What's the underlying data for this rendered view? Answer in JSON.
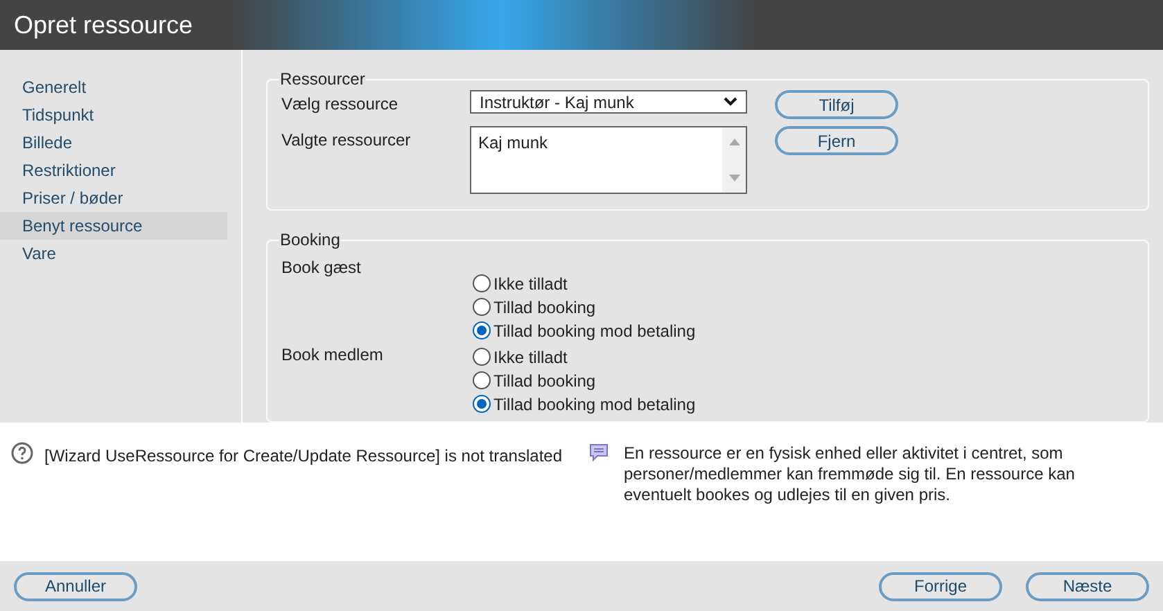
{
  "window": {
    "title": "Opret ressource"
  },
  "sidebar": {
    "items": [
      {
        "label": "Generelt",
        "selected": false
      },
      {
        "label": "Tidspunkt",
        "selected": false
      },
      {
        "label": "Billede",
        "selected": false
      },
      {
        "label": "Restriktioner",
        "selected": false
      },
      {
        "label": "Priser / bøder",
        "selected": false
      },
      {
        "label": "Benyt ressource",
        "selected": true
      },
      {
        "label": "Vare",
        "selected": false
      }
    ]
  },
  "resources": {
    "legend": "Ressourcer",
    "select_label": "Vælg ressource",
    "select_value": "Instruktør - Kaj munk",
    "selected_label": "Valgte ressourcer",
    "selected_items": [
      "Kaj munk"
    ],
    "buttons": [
      "Tilføj",
      "Fjern"
    ]
  },
  "booking": {
    "legend": "Booking",
    "groups": [
      {
        "label": "Book gæst",
        "options": [
          {
            "label": "Ikke tilladt",
            "selected": false
          },
          {
            "label": "Tillad booking",
            "selected": false
          },
          {
            "label": "Tillad booking mod betaling",
            "selected": true
          }
        ]
      },
      {
        "label": "Book medlem",
        "options": [
          {
            "label": "Ikke tilladt",
            "selected": false
          },
          {
            "label": "Tillad booking",
            "selected": false
          },
          {
            "label": "Tillad booking mod betaling",
            "selected": true
          }
        ]
      }
    ]
  },
  "help": {
    "message": "[Wizard UseRessource for Create/Update Ressource] is not translated",
    "description": "En ressource er en fysisk enhed eller aktivitet i centret, som personer/medlemmer kan fremmøde sig til. En ressource kan eventuelt bookes og udlejes til en given pris."
  },
  "footer": {
    "cancel": "Annuller",
    "back": "Forrige",
    "next": "Næste"
  }
}
